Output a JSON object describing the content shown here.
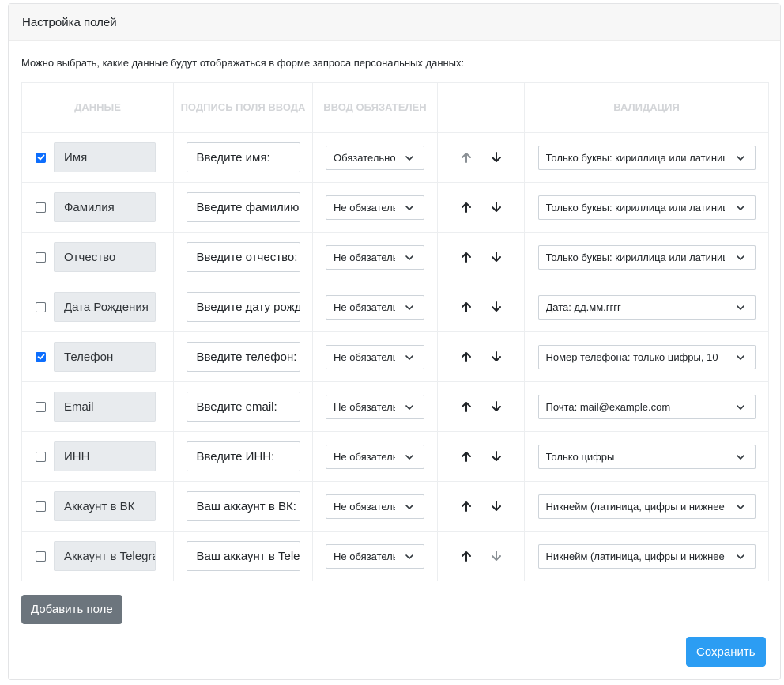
{
  "header": {
    "title": "Настройка полей"
  },
  "description": "Можно выбрать, какие данные будут отображаться в форме запроса персональных данных:",
  "columns": {
    "data": "ДАННЫЕ",
    "caption": "ПОДПИСЬ ПОЛЯ ВВОДА",
    "required": "ВВОД ОБЯЗАТЕЛЕН",
    "move": "",
    "validation": "ВАЛИДАЦИЯ"
  },
  "rows": [
    {
      "checked": true,
      "name": "Имя",
      "caption": "Введите имя:",
      "required": "Обязательно",
      "validation": "Только буквы: кириллица или латиница",
      "up_enabled": false,
      "down_enabled": true
    },
    {
      "checked": false,
      "name": "Фамилия",
      "caption": "Введите фамилию:",
      "required": "Не обязательно",
      "validation": "Только буквы: кириллица или латиница",
      "up_enabled": true,
      "down_enabled": true
    },
    {
      "checked": false,
      "name": "Отчество",
      "caption": "Введите отчество:",
      "required": "Не обязательно",
      "validation": "Только буквы: кириллица или латиница",
      "up_enabled": true,
      "down_enabled": true
    },
    {
      "checked": false,
      "name": "Дата Рождения",
      "caption": "Введите дату рождения:",
      "required": "Не обязательно",
      "validation": "Дата: дд.мм.гггг",
      "up_enabled": true,
      "down_enabled": true
    },
    {
      "checked": true,
      "name": "Телефон",
      "caption": "Введите телефон:",
      "required": "Не обязательно",
      "validation": "Номер телефона: только цифры, 10",
      "up_enabled": true,
      "down_enabled": true
    },
    {
      "checked": false,
      "name": "Email",
      "caption": "Введите email:",
      "required": "Не обязательно",
      "validation": "Почта: mail@example.com",
      "up_enabled": true,
      "down_enabled": true
    },
    {
      "checked": false,
      "name": "ИНН",
      "caption": "Введите ИНН:",
      "required": "Не обязательно",
      "validation": "Только цифры",
      "up_enabled": true,
      "down_enabled": true
    },
    {
      "checked": false,
      "name": "Аккаунт в ВК",
      "caption": "Ваш аккаунт в ВК:",
      "required": "Не обязательно",
      "validation": "Никнейм (латиница, цифры и нижнее подчеркивание)",
      "up_enabled": true,
      "down_enabled": true
    },
    {
      "checked": false,
      "name": "Аккаунт в Telegram",
      "caption": "Ваш аккаунт в Telegram:",
      "required": "Не обязательно",
      "validation": "Никнейм (латиница, цифры и нижнее подчеркивание)",
      "up_enabled": true,
      "down_enabled": false
    }
  ],
  "buttons": {
    "add_field": "Добавить поле",
    "save": "Сохранить"
  },
  "colors": {
    "checkbox_checked": "#0d6efd",
    "add_button": "#6c757d",
    "save_button": "#2c9df3",
    "arrow_active": "#212529",
    "arrow_disabled": "#8a9095"
  }
}
